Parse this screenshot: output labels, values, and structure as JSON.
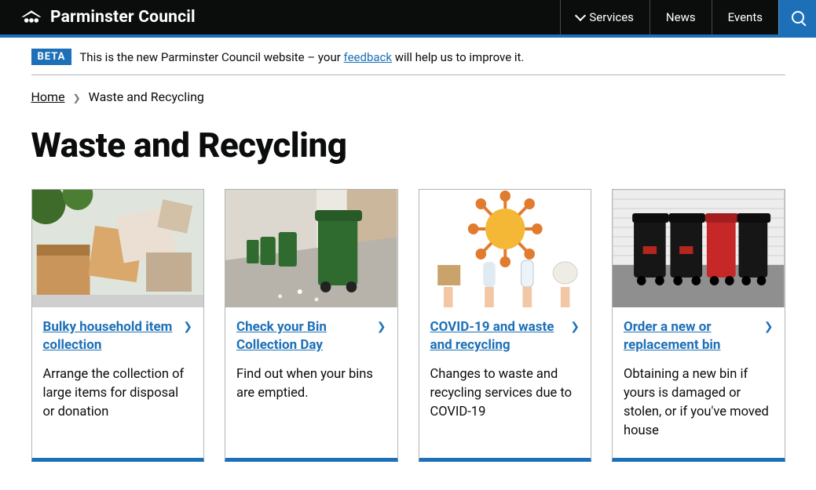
{
  "header": {
    "brand": "Parminster Council",
    "nav": {
      "services": "Services",
      "news": "News",
      "events": "Events"
    }
  },
  "beta": {
    "tag": "BETA",
    "pre": "This is the new Parminster Council website – your ",
    "link": "feedback",
    "post": " will help us to improve it."
  },
  "breadcrumb": {
    "home": "Home",
    "current": "Waste and Recycling"
  },
  "page": {
    "title": "Waste and Recycling"
  },
  "cards": [
    {
      "title": "Bulky household item collection",
      "desc": "Arrange the collection of large items for disposal or donation"
    },
    {
      "title": "Check your Bin Collection Day",
      "desc": "Find out when your bins are emptied."
    },
    {
      "title": "COVID-19 and waste and recycling",
      "desc": "Changes to waste and recycling services due to COVID-19"
    },
    {
      "title": "Order a new or replacement bin",
      "desc": "Obtaining a new bin if yours is damaged or stolen, or if you've moved house"
    }
  ]
}
